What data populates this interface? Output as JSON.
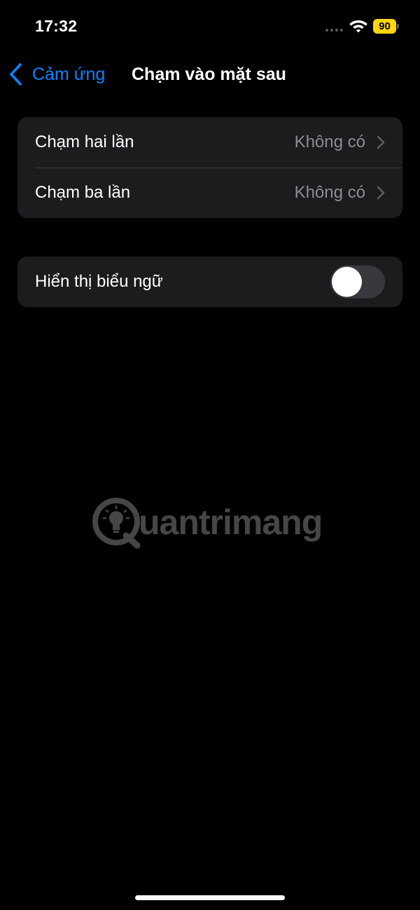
{
  "status_bar": {
    "time": "17:32",
    "battery_level": "90",
    "battery_color": "#ffd60a",
    "icons": [
      "signal-dots-icon",
      "wifi-icon",
      "battery-icon"
    ]
  },
  "nav": {
    "back_label": "Cảm ứng",
    "title": "Chạm vào mặt sau",
    "accent_color": "#0a84ff"
  },
  "tap_actions": [
    {
      "label": "Chạm hai lần",
      "value": "Không có"
    },
    {
      "label": "Chạm ba lần",
      "value": "Không có"
    }
  ],
  "banner_setting": {
    "label": "Hiển thị biểu ngữ",
    "enabled": false
  },
  "watermark": {
    "text": "uantrimang"
  }
}
